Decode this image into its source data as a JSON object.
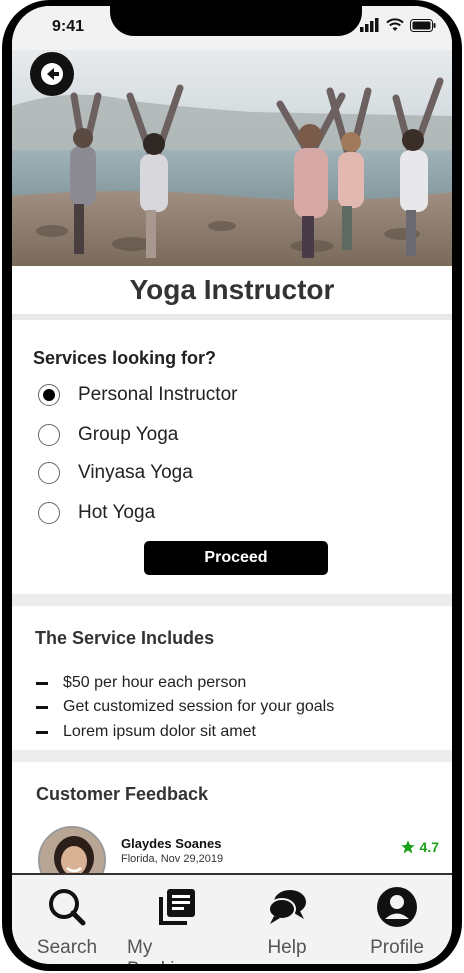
{
  "status_bar": {
    "time": "9:41"
  },
  "hero": {
    "image": "yoga-class-on-beach"
  },
  "header": {
    "title": "Yoga Instructor"
  },
  "services": {
    "heading": "Services looking for?",
    "options": [
      {
        "label": "Personal Instructor",
        "selected": true
      },
      {
        "label": "Group Yoga",
        "selected": false
      },
      {
        "label": "Vinyasa Yoga",
        "selected": false
      },
      {
        "label": "Hot Yoga",
        "selected": false
      }
    ],
    "proceed_label": "Proceed"
  },
  "includes": {
    "heading": "The Service Includes",
    "items": [
      "$50 per hour each person",
      "Get customized session for your goals",
      "Lorem ipsum dolor sit amet"
    ]
  },
  "feedback": {
    "heading": "Customer Feedback",
    "reviews": [
      {
        "name": "Glaydes Soanes",
        "meta": "Florida, Nov 29,2019",
        "rating": "4.7"
      }
    ]
  },
  "tab_bar": {
    "tabs": [
      {
        "label": "Search",
        "icon": "search-icon"
      },
      {
        "label": "My Bookings",
        "icon": "bookings-icon"
      },
      {
        "label": "Help",
        "icon": "chat-bubbles-icon"
      },
      {
        "label": "Profile",
        "icon": "profile-icon"
      }
    ]
  },
  "colors": {
    "accent": "#000000",
    "rating": "#1aa31a",
    "divider": "#ececec"
  }
}
